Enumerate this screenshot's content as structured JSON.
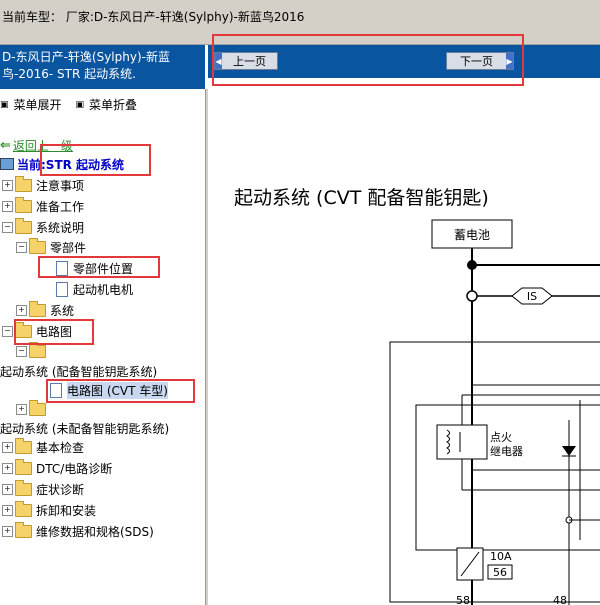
{
  "topbar": {
    "model_text": "当前车型：  厂家:D-东风日产-轩逸(Sylphy)-新蓝鸟2016"
  },
  "lefthead": {
    "line1": "D-东风日产-轩逸(Sylphy)-新蓝",
    "line2": "鸟-2016- STR 起动系统."
  },
  "menu": {
    "expand": "菜单展开",
    "collapse": "菜单折叠"
  },
  "tree": {
    "back": "返回上一级",
    "current": "当前:STR 起动系统",
    "items": {
      "notes": "注意事项",
      "prep": "准备工作",
      "sysdesc": "系统说明",
      "parts": "零部件",
      "parts_loc": "零部件位置",
      "starter_motor": "起动机电机",
      "system": "系统",
      "circuit": "电路图",
      "start_sys_key": "起动系统 (配备智能钥匙系统)",
      "circuit_cvt": "电路图 (CVT 车型)",
      "start_sys_nokey": "起动系统 (未配备智能钥匙系统)",
      "basic_check": "基本检查",
      "dtc": "DTC/电路诊断",
      "symptom": "症状诊断",
      "removal": "拆卸和安装",
      "sds": "维修数据和规格(SDS)"
    }
  },
  "nav": {
    "prev": "上一页",
    "next": "下一页"
  },
  "diagram": {
    "title": "起动系统 (CVT 配备智能钥匙)",
    "battery": "蓄电池",
    "is_label": "IS",
    "relay_l1": "点火",
    "relay_l2": "继电器",
    "fuse_amp": "10A",
    "fuse_no": "56",
    "conn1": "58",
    "conn2": "48"
  },
  "colors": {
    "header_blue": "#0a55a0",
    "highlight_red": "#e23a3a",
    "link_green": "#2a8a2a",
    "current_blue": "#0000c8",
    "selected_bg": "#c8d8f0"
  }
}
